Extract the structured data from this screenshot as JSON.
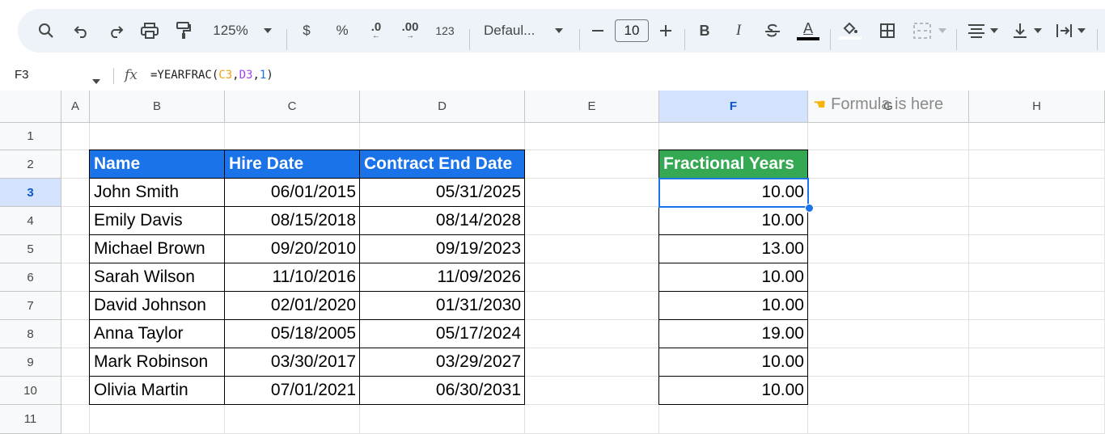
{
  "toolbar": {
    "zoom": "125%",
    "currency": "$",
    "percent": "%",
    "decrease_decimals": ".0",
    "increase_decimals": ".00",
    "number_format": "123",
    "font": "Defaul...",
    "font_size": "10",
    "bold": "B",
    "italic": "I",
    "text_color_letter": "A"
  },
  "formula_bar": {
    "cell_ref": "F3",
    "fx": "fx",
    "formula_prefix": "=YEARFRAC(",
    "arg1": "C3",
    "comma1": ",",
    "arg2": "D3",
    "comma2": ",",
    "arg3": "1",
    "formula_suffix": ")"
  },
  "columns": [
    "A",
    "B",
    "C",
    "D",
    "E",
    "F",
    "G",
    "H"
  ],
  "rows": [
    "1",
    "2",
    "3",
    "4",
    "5",
    "6",
    "7",
    "8",
    "9",
    "10",
    "11"
  ],
  "headers": {
    "name": "Name",
    "hire_date": "Hire Date",
    "contract_end": "Contract End Date",
    "fractional": "Fractional Years"
  },
  "header_colors": {
    "blue": "#1a73e8",
    "green": "#34a853",
    "selection": "#1a73e8"
  },
  "data": [
    {
      "name": "John Smith",
      "hire": "06/01/2015",
      "end": "05/31/2025",
      "years": "10.00"
    },
    {
      "name": "Emily Davis",
      "hire": "08/15/2018",
      "end": "08/14/2028",
      "years": "10.00"
    },
    {
      "name": "Michael Brown",
      "hire": "09/20/2010",
      "end": "09/19/2023",
      "years": "13.00"
    },
    {
      "name": "Sarah Wilson",
      "hire": "11/10/2016",
      "end": "11/09/2026",
      "years": "10.00"
    },
    {
      "name": "David Johnson",
      "hire": "02/01/2020",
      "end": "01/31/2030",
      "years": "10.00"
    },
    {
      "name": "Anna Taylor",
      "hire": "05/18/2005",
      "end": "05/17/2024",
      "years": "19.00"
    },
    {
      "name": "Mark Robinson",
      "hire": "03/30/2017",
      "end": "03/29/2027",
      "years": "10.00"
    },
    {
      "name": "Olivia Martin",
      "hire": "07/01/2021",
      "end": "06/30/2031",
      "years": "10.00"
    }
  ],
  "note": {
    "icon": "pointing-hand-icon",
    "text": "Formula is here"
  }
}
